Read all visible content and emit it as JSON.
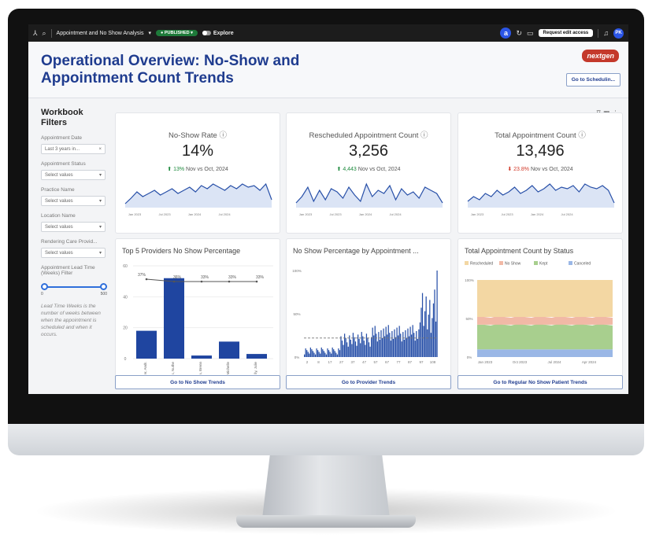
{
  "topbar": {
    "workbook_name": "Appointment and No Show Analysis",
    "status_badge": "PUBLISHED",
    "explore_label": "Explore",
    "request_button": "Request edit access",
    "avatar_initials": "PK",
    "app_logo_letter": "a"
  },
  "header": {
    "title": "Operational Overview: No-Show and Appointment Count Trends",
    "brand_logo": "nextgen",
    "goto_button": "Go to Schedulin..."
  },
  "filters": {
    "heading": "Workbook Filters",
    "items": [
      {
        "label": "Appointment Date",
        "value": "Last 3 years in...",
        "icon": "calendar-icon"
      },
      {
        "label": "Appointment Status",
        "value": "Select values"
      },
      {
        "label": "Practice Name",
        "value": "Select values"
      },
      {
        "label": "Location Name",
        "value": "Select values"
      },
      {
        "label": "Rendering Care Provid...",
        "value": "Select values"
      }
    ],
    "lead_time_label": "Appointment Lead Time (Weeks) Filter",
    "slider_min": "0",
    "slider_max": "500",
    "note": "Lead Time Weeks is the number of weeks between when the appointment is scheduled and when it occurs."
  },
  "kpis": [
    {
      "name": "No-Show Rate",
      "value": "14%",
      "delta": "13%",
      "delta_dir": "up",
      "comparison": "Nov vs Oct, 2024"
    },
    {
      "name": "Rescheduled Appointment Count",
      "value": "3,256",
      "delta": "4,443",
      "delta_dir": "up",
      "comparison": "Nov vs Oct, 2024"
    },
    {
      "name": "Total Appointment Count",
      "value": "13,496",
      "delta": "23.8%",
      "delta_dir": "down",
      "comparison": "Nov vs Oct, 2024"
    }
  ],
  "spark_axis_labels": [
    "Jan 2023",
    "Jul 2023",
    "Jan 2024",
    "Jul 2024"
  ],
  "charts": {
    "providers_title": "Top 5 Providers No Show Percentage",
    "appt_pct_title": "No Show Percentage by Appointment ...",
    "status_title": "Total Appointment Count by Status"
  },
  "chart_data": [
    {
      "type": "bar",
      "title": "Top 5 Providers No Show Percentage",
      "categories": [
        "Alexander, Andr.",
        "Thomas, Nuthe",
        "Virginia, Brenn",
        "Wise, Michelle",
        "Tully, Julie"
      ],
      "values": [
        18,
        52,
        2,
        11,
        3
      ],
      "line_labels": [
        "37%",
        "36%",
        "33%",
        "33%",
        "33%"
      ],
      "yticks": [
        "60",
        "40",
        "20",
        "0"
      ],
      "ylim": [
        0,
        60
      ]
    },
    {
      "type": "bar",
      "title": "No Show Percentage by Appointment ...",
      "x_ticks": [
        "2",
        "8",
        "17",
        "27",
        "37",
        "47",
        "57",
        "67",
        "77",
        "87",
        "97",
        "108"
      ],
      "yticks": [
        "100%",
        "50%",
        "0%"
      ],
      "ylim": [
        0,
        100
      ]
    },
    {
      "type": "area",
      "title": "Total Appointment Count by Status",
      "legend": [
        "Rescheduled",
        "No Show",
        "Kept",
        "Canceled"
      ],
      "colors": [
        "#f3d7a3",
        "#f1b9a6",
        "#a8cf8e",
        "#9ab7e6"
      ],
      "yticks": [
        "100%",
        "50%",
        "0%"
      ],
      "x_ticks": [
        "Jan 2023",
        "Oct 2023",
        "Jul 2024",
        "Apr 2024"
      ]
    }
  ],
  "buttons": {
    "no_show_trends": "Go to No Show Trends",
    "provider_trends": "Go to Provider Trends",
    "regular_no_show": "Go to Regular No Show Patient Trends"
  },
  "colors": {
    "accent": "#1f3c8f",
    "bar": "#2850a8",
    "up": "#1e8a3e",
    "down": "#d23a2a"
  }
}
